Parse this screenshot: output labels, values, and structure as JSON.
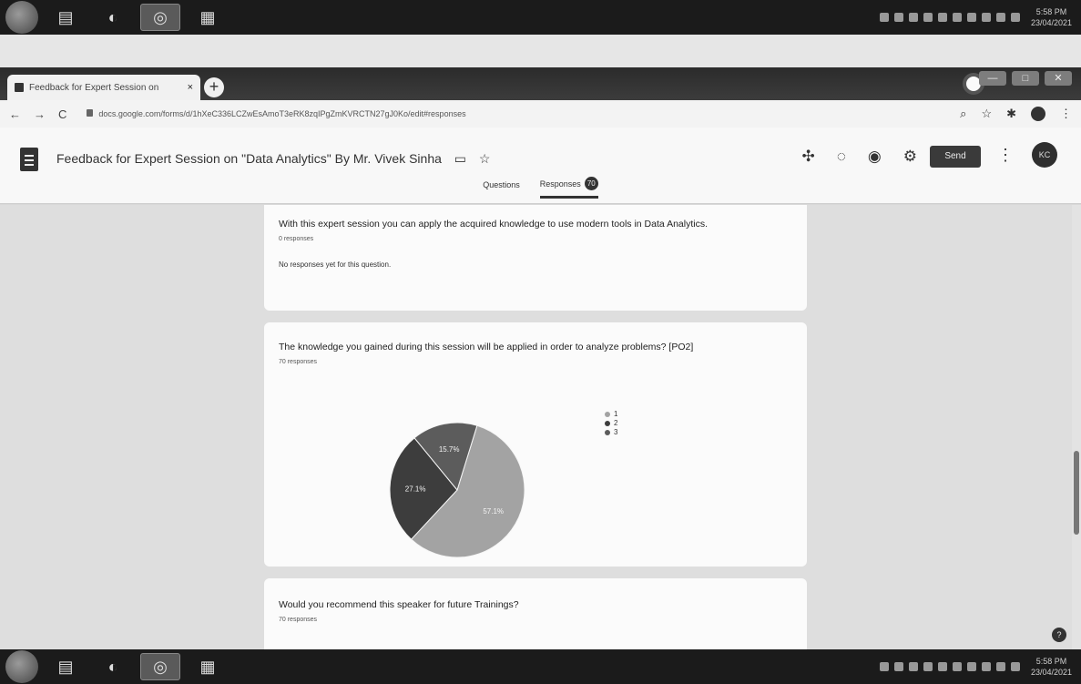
{
  "taskbar": {
    "apps": [
      {
        "name": "start-orb",
        "glyph": "◉"
      },
      {
        "name": "file-explorer",
        "glyph": "▤"
      },
      {
        "name": "media-player",
        "glyph": "◐"
      },
      {
        "name": "chrome",
        "glyph": "◎"
      },
      {
        "name": "calendar-app",
        "glyph": "▦"
      }
    ],
    "time": "5:58 PM",
    "date": "23/04/2021"
  },
  "browser": {
    "tab_title": "Feedback for Expert Session on",
    "tab_close": "×",
    "new_tab": "+",
    "url": "docs.google.com/forms/d/1hXeC336LCZwEsAmoT3eRK8zqIPgZmKVRCTN27gJ0Ko/edit#responses",
    "nav": {
      "back": "←",
      "forward": "→",
      "reload": "C"
    },
    "window_controls": {
      "minimize": "—",
      "maximize": "□",
      "close": "✕"
    }
  },
  "form": {
    "title": "Feedback for Expert Session on \"Data Analytics\" By Mr. Vivek Sinha",
    "folder_icon": "▭",
    "star_icon": "☆",
    "send_label": "Send",
    "more_icon": "⋮",
    "avatar_initials": "KC",
    "tabs": {
      "questions": "Questions",
      "responses": "Responses",
      "responses_count": "70"
    }
  },
  "questions": [
    {
      "text": "With this expert session you can apply the acquired knowledge to use modern tools in Data Analytics.",
      "response_count": "0 responses",
      "empty_message": "No responses yet for this question."
    },
    {
      "text": "The knowledge you gained during this session will be applied in order to analyze problems? [PO2]",
      "response_count": "70 responses"
    },
    {
      "text": "Would you recommend this speaker for future Trainings?",
      "response_count": "70 responses"
    }
  ],
  "chart_data": {
    "type": "pie",
    "title": "",
    "categories": [
      "1",
      "2",
      "3"
    ],
    "values": [
      57.1,
      27.1,
      15.7
    ],
    "labels": [
      "57.1%",
      "27.1%",
      "15.7%"
    ],
    "colors": [
      "#a3a3a3",
      "#3d3d3d",
      "#5c5c5c"
    ],
    "legend_position": "right"
  }
}
